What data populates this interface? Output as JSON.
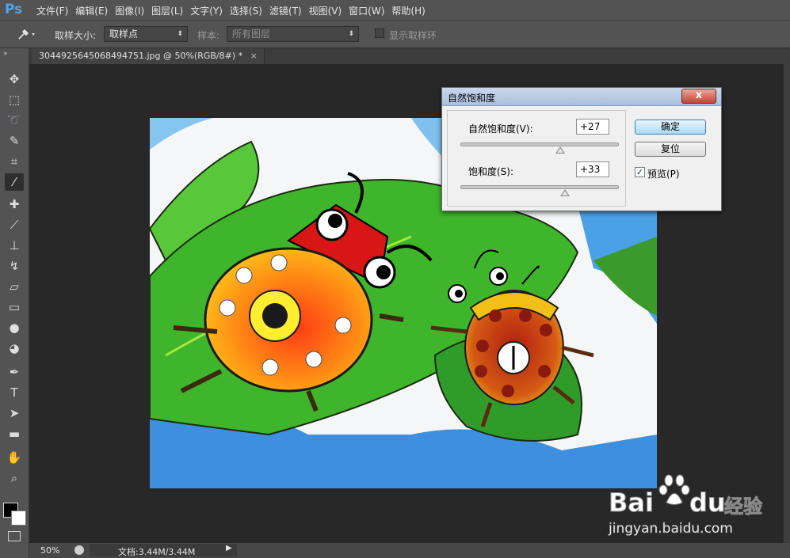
{
  "app": {
    "logo": "Ps"
  },
  "menu": [
    "文件(F)",
    "编辑(E)",
    "图像(I)",
    "图层(L)",
    "文字(Y)",
    "选择(S)",
    "滤镜(T)",
    "视图(V)",
    "窗口(W)",
    "帮助(H)"
  ],
  "options": {
    "tool_icon": "eyedropper-icon",
    "sample_size_label": "取样大小:",
    "sample_size_value": "取样点",
    "sample_label": "样本:",
    "sample_value": "所有图层",
    "show_ring_label": "显示取样环"
  },
  "document": {
    "tab_title": "3044925645068494751.jpg @ 50%(RGB/8#) *",
    "close": "×"
  },
  "status": {
    "zoom": "50%",
    "doc_info": "文档:3.44M/3.44M"
  },
  "dialog": {
    "title": "自然饱和度",
    "close": "x",
    "vibrance_label": "自然饱和度(V):",
    "vibrance_value": "+27",
    "vibrance": 27,
    "saturation_label": "饱和度(S):",
    "saturation_value": "+33",
    "saturation": 33,
    "ok": "确定",
    "reset": "复位",
    "preview_label": "预览(P)",
    "preview_checked": true
  },
  "watermark": {
    "brand": "Bai",
    "brand_suffix": "du",
    "site_cn": "经验",
    "url": "jingyan.baidu.com"
  },
  "tools": [
    "move-tool-icon",
    "marquee-tool-icon",
    "lasso-tool-icon",
    "quick-select-icon",
    "crop-tool-icon",
    "eyedropper-tool-icon",
    "healing-brush-icon",
    "brush-tool-icon",
    "clone-stamp-icon",
    "history-brush-icon",
    "eraser-tool-icon",
    "gradient-tool-icon",
    "blur-tool-icon",
    "dodge-tool-icon",
    "pen-tool-icon",
    "type-tool-icon",
    "path-select-icon",
    "rectangle-tool-icon",
    "hand-tool-icon",
    "zoom-tool-icon"
  ]
}
